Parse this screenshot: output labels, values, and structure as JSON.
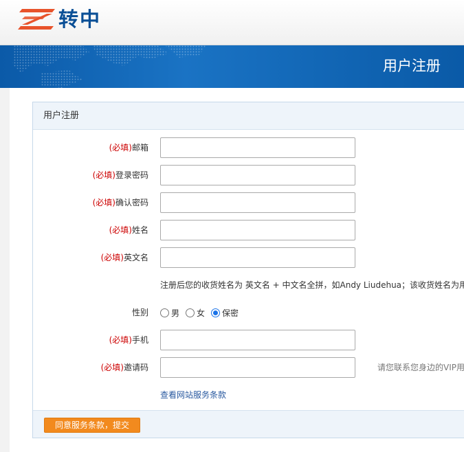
{
  "header": {
    "logo_text": "转中",
    "banner_title": "用户注册"
  },
  "panel": {
    "title": "用户注册"
  },
  "form": {
    "required_prefix": "(必填)",
    "fields": {
      "email": {
        "label": "邮箱",
        "value": ""
      },
      "password": {
        "label": "登录密码",
        "value": ""
      },
      "confirm_password": {
        "label": "确认密码",
        "value": ""
      },
      "name": {
        "label": "姓名",
        "value": ""
      },
      "english_name": {
        "label": "英文名",
        "value": ""
      },
      "phone": {
        "label": "手机",
        "value": ""
      },
      "invite_code": {
        "label": "邀请码",
        "value": ""
      }
    },
    "name_note": "注册后您的收货姓名为 英文名 + 中文名全拼，如Andy Liudehua；该收货姓名为用户",
    "invite_hint": "请您联系您身边的VIP用户",
    "gender": {
      "label": "性别",
      "options": [
        "男",
        "女",
        "保密"
      ],
      "selected": "保密"
    },
    "terms_link": "查看网站服务条款",
    "submit_label": "同意服务条款，提交"
  },
  "colors": {
    "brand_blue": "#0a4f96",
    "banner_blue": "#0b5aa8",
    "required_red": "#cc0000",
    "submit_orange": "#f28a1e"
  }
}
